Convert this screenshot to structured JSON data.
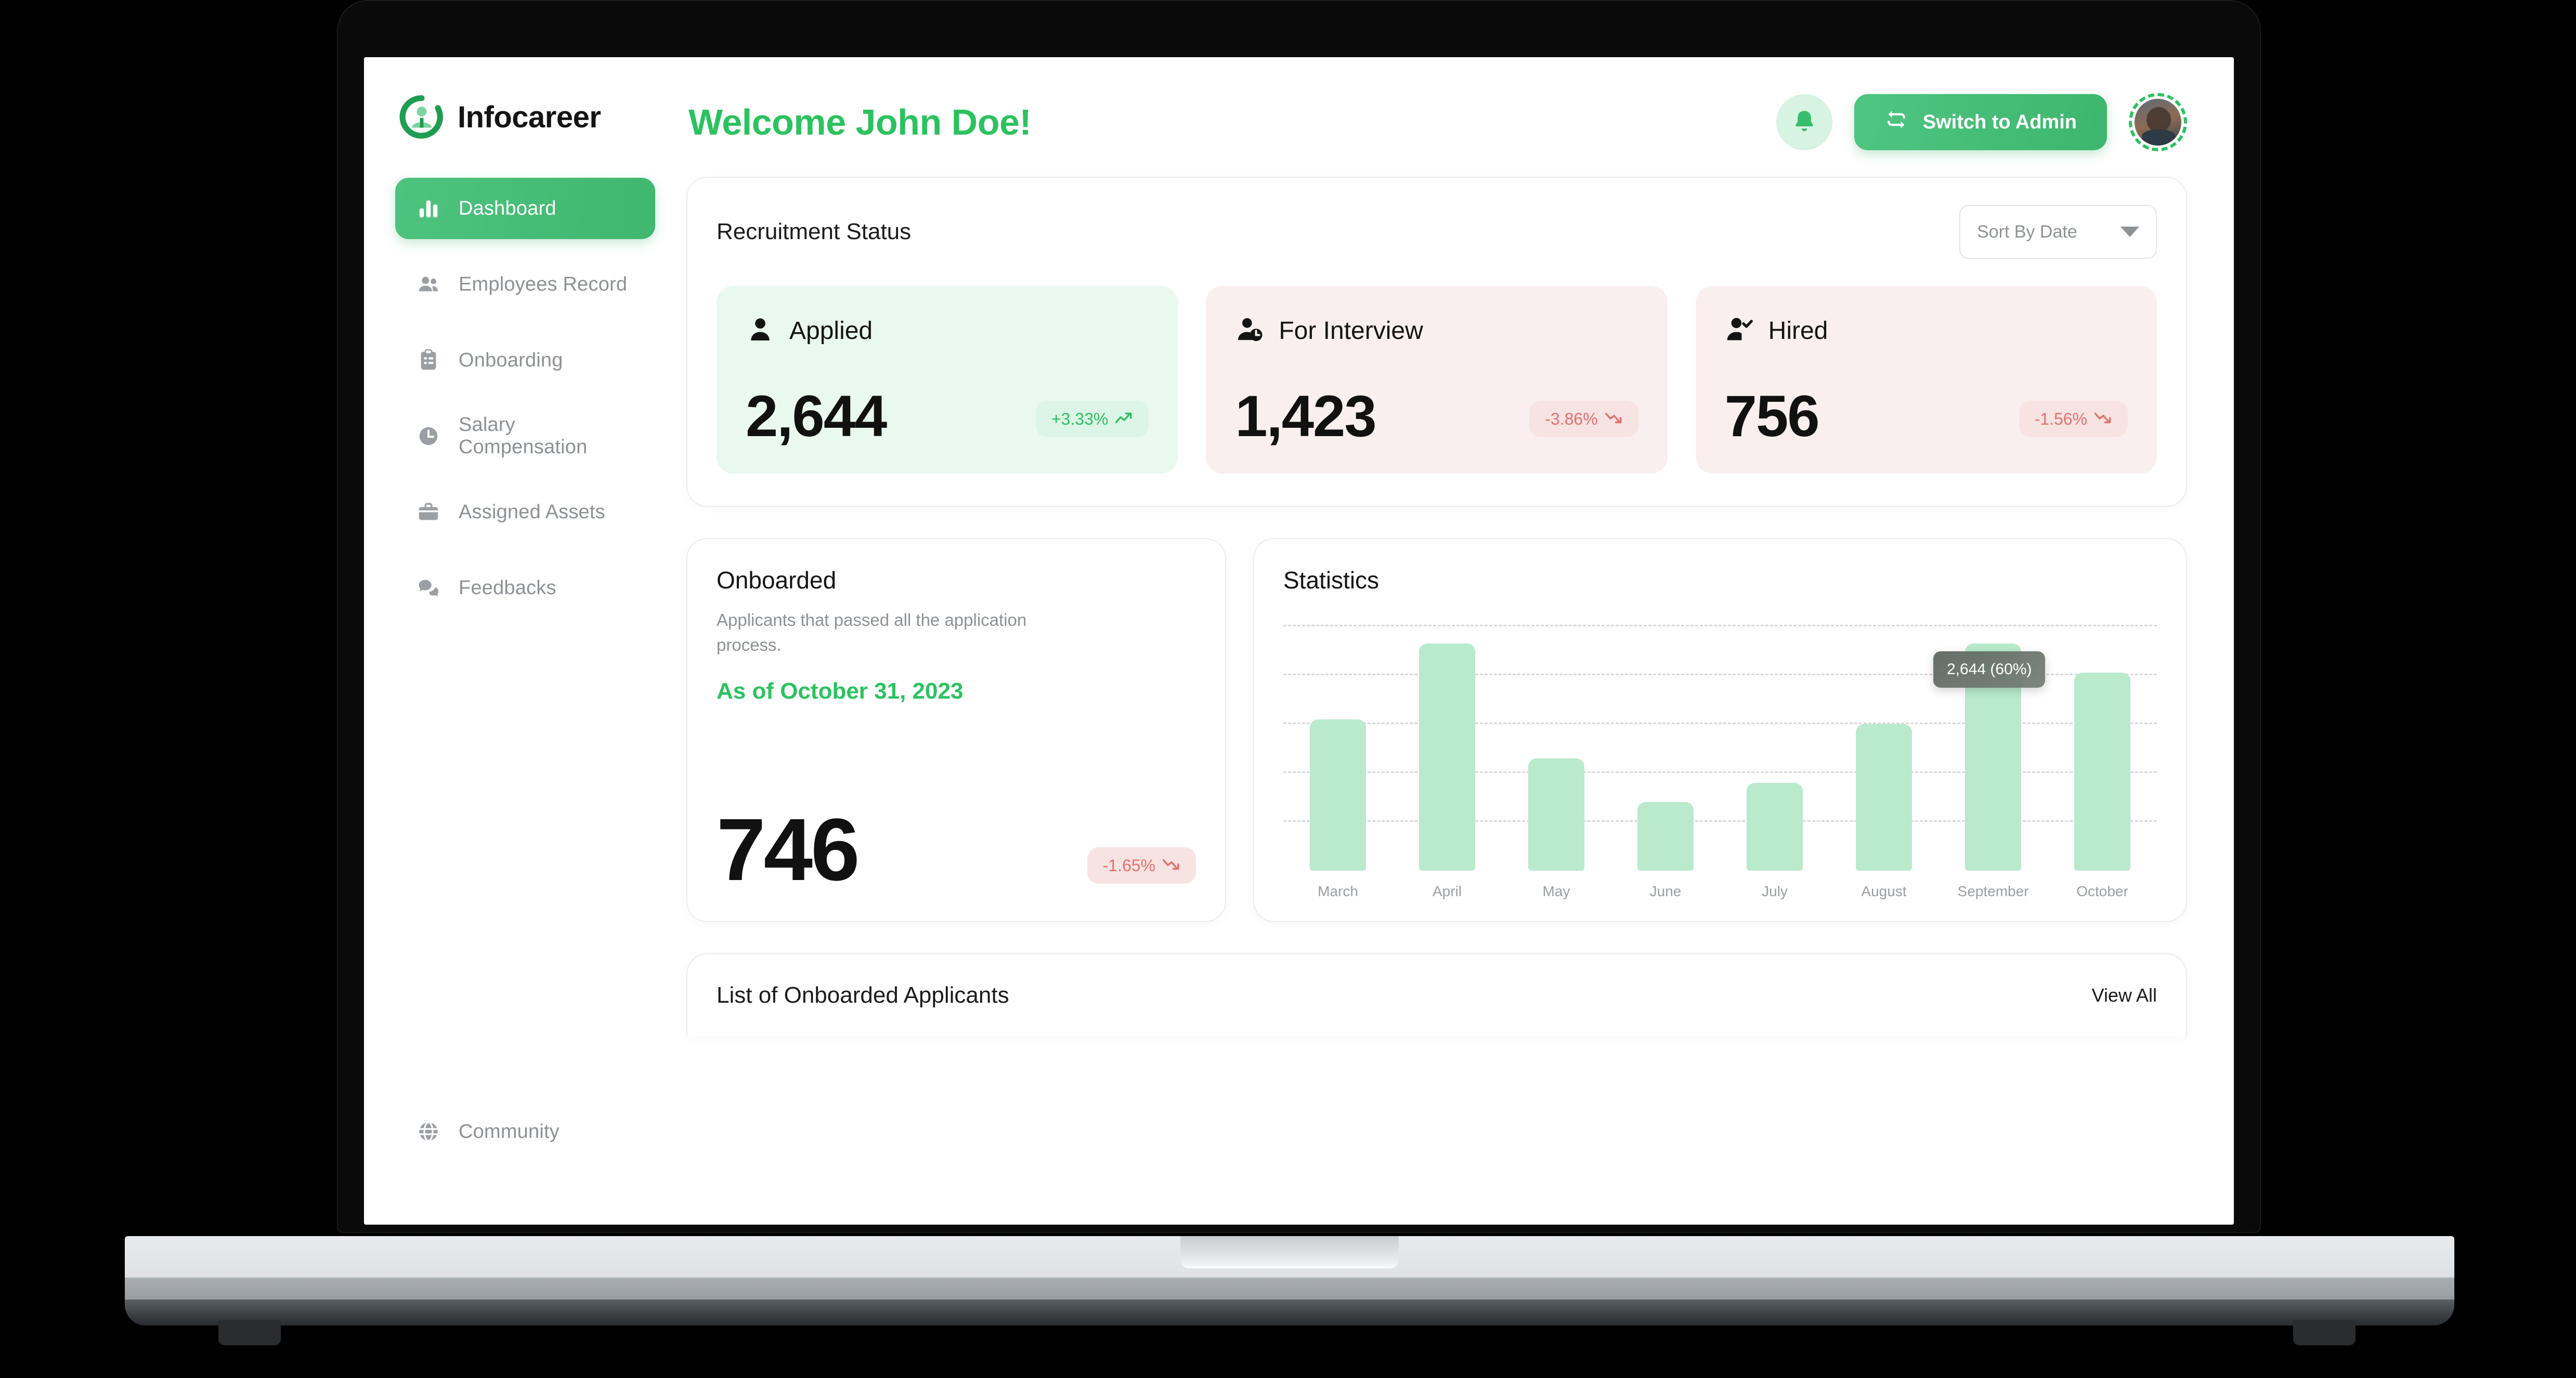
{
  "brand": {
    "name": "Infocareer",
    "logo_icon": "circle-person-logo"
  },
  "sidebar": {
    "items": [
      {
        "label": "Dashboard",
        "icon": "bar-chart-icon",
        "active": true
      },
      {
        "label": "Employees Record",
        "icon": "people-icon",
        "active": false
      },
      {
        "label": "Onboarding",
        "icon": "clipboard-icon",
        "active": false
      },
      {
        "label": "Salary Compensation",
        "icon": "clock-icon",
        "active": false
      },
      {
        "label": "Assigned Assets",
        "icon": "briefcase-icon",
        "active": false
      },
      {
        "label": "Feedbacks",
        "icon": "chat-icon",
        "active": false
      }
    ],
    "bottom": {
      "label": "Community",
      "icon": "globe-icon"
    }
  },
  "header": {
    "welcome": "Welcome John Doe!",
    "bell_icon": "bell-icon",
    "switch_label": "Switch to Admin",
    "switch_icon": "swap-arrows-icon",
    "avatar_icon": "user-avatar"
  },
  "recruitment": {
    "title": "Recruitment Status",
    "sort": {
      "value": "Sort By Date",
      "caret_icon": "chevron-down-icon"
    },
    "cards": [
      {
        "label": "Applied",
        "icon": "person-icon",
        "value": "2,644",
        "delta": "+3.33%",
        "direction": "up",
        "tone": "green"
      },
      {
        "label": "For Interview",
        "icon": "person-clock-icon",
        "value": "1,423",
        "delta": "-3.86%",
        "direction": "down",
        "tone": "pink"
      },
      {
        "label": "Hired",
        "icon": "person-check-icon",
        "value": "756",
        "delta": "-1.56%",
        "direction": "down",
        "tone": "pink"
      }
    ]
  },
  "onboarded": {
    "title": "Onboarded",
    "description": "Applicants that passed all the application process.",
    "as_of": "As of October 31, 2023",
    "value": "746",
    "delta": "-1.65%",
    "direction": "down"
  },
  "statistics": {
    "title": "Statistics"
  },
  "applicants": {
    "title": "List of Onboarded Applicants",
    "view_all": "View All"
  },
  "colors": {
    "accent_green": "#2CC25F",
    "bar_green": "#B9EACB",
    "card_green": "#E9F9EF",
    "card_pink": "#FAEFEF",
    "delta_up": "#2FC063",
    "delta_down": "#E4716F"
  },
  "chart_data": {
    "type": "bar",
    "title": "Statistics",
    "xlabel": "",
    "ylabel": "",
    "categories": [
      "March",
      "April",
      "May",
      "June",
      "July",
      "August",
      "September",
      "October"
    ],
    "values": [
      62,
      93,
      46,
      28,
      36,
      60,
      93,
      81
    ],
    "ylim": [
      0,
      100
    ],
    "grid": true,
    "gridlines": [
      20,
      40,
      60,
      80,
      100
    ],
    "legend": "none",
    "annotations": [
      {
        "category": "September",
        "text": "2,644 (60%)",
        "value": 2644,
        "percent": 60
      }
    ]
  }
}
